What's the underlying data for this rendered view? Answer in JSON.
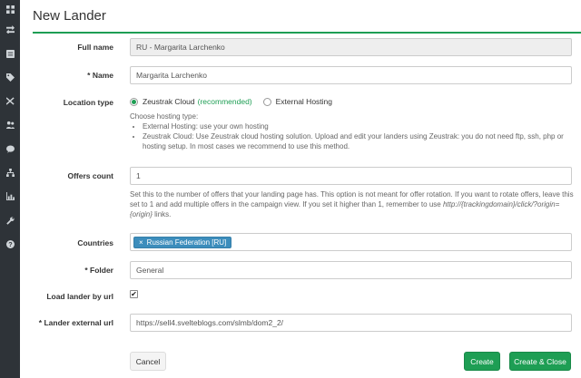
{
  "sidebar": {
    "icons": [
      "dashboard-icon",
      "transfer-icon",
      "list-icon",
      "tag-icon",
      "shuffle-icon",
      "users-icon",
      "chat-icon",
      "sitemap-icon",
      "chart-icon",
      "wrench-icon",
      "help-icon"
    ]
  },
  "page": {
    "title": "New Lander"
  },
  "form": {
    "full_name": {
      "label": "Full name",
      "value": "RU - Margarita Larchenko"
    },
    "name": {
      "label": "* Name",
      "value": "Margarita Larchenko"
    },
    "location": {
      "label": "Location type",
      "option1": "Zeustrak Cloud",
      "option1_note": "(recommended)",
      "option2": "External Hosting",
      "help_title": "Choose hosting type:",
      "help_item1": "External Hosting: use your own hosting",
      "help_item2": "Zeustrak Cloud: Use Zeustrak cloud hosting solution. Upload and edit your landers using Zeustrak: you do not need ftp, ssh, php or hosting setup. In most cases we recommend to use this method."
    },
    "offers": {
      "label": "Offers count",
      "value": "1",
      "help_text": "Set this to the number of offers that your landing page has. This option is not meant for offer rotation. If you want to rotate offers, leave this set to 1 and add multiple offers in the campaign view. If you set it higher than 1, remember to use",
      "help_url": "http://{trackingdomain}/click/?origin={origin}",
      "help_suffix": " links."
    },
    "countries": {
      "label": "Countries",
      "tag_remove": "×",
      "tag": "Russian Federation [RU]"
    },
    "folder": {
      "label": "* Folder",
      "value": "General"
    },
    "load_by_url": {
      "label": "Load lander by url",
      "checked": "✔"
    },
    "external_url": {
      "label": "* Lander external url",
      "value": "https://sell4.svelteblogs.com/slmb/dom2_2/"
    }
  },
  "buttons": {
    "cancel": "Cancel",
    "create": "Create",
    "create_close": "Create & Close"
  },
  "colors": {
    "accent": "#1e9e54",
    "tag": "#3c8dbc",
    "sidebar": "#2e3338"
  }
}
